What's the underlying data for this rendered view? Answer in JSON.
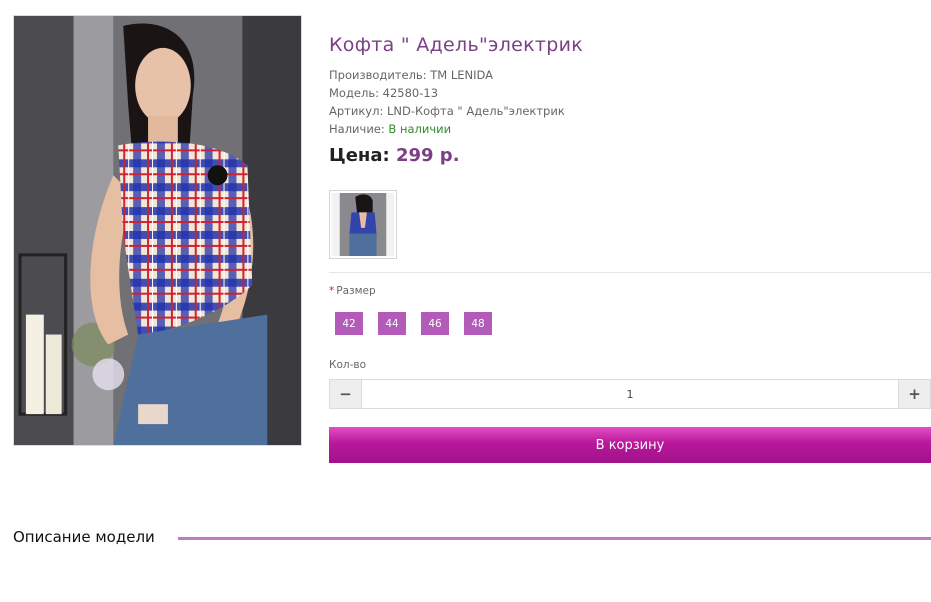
{
  "product": {
    "title": "Кофта \" Адель\"электрик",
    "manufacturer": "Производитель: TM LENIDA",
    "model": "Модель: 42580-13",
    "sku": "Артикул: LND-Кофта \" Адель\"электрик",
    "availability_label": "Наличие: ",
    "availability_value": "В наличии",
    "price_label": "Цена: ",
    "price_value": "299 р."
  },
  "options": {
    "size_required_mark": "*",
    "size_label": "Размер",
    "sizes": [
      "42",
      "44",
      "46",
      "48"
    ]
  },
  "quantity": {
    "label": "Кол-во",
    "value": "1",
    "minus_icon": "minus-icon",
    "plus_icon": "plus-icon"
  },
  "cart": {
    "button_label": "В корзину"
  },
  "description": {
    "heading": "Описание модели"
  },
  "colors": {
    "accent": "#7b3f86",
    "size_button": "#b35bb8",
    "cart_button": "#b8179a",
    "in_stock": "#2e8b2e",
    "section_line": "#c07bc5"
  }
}
